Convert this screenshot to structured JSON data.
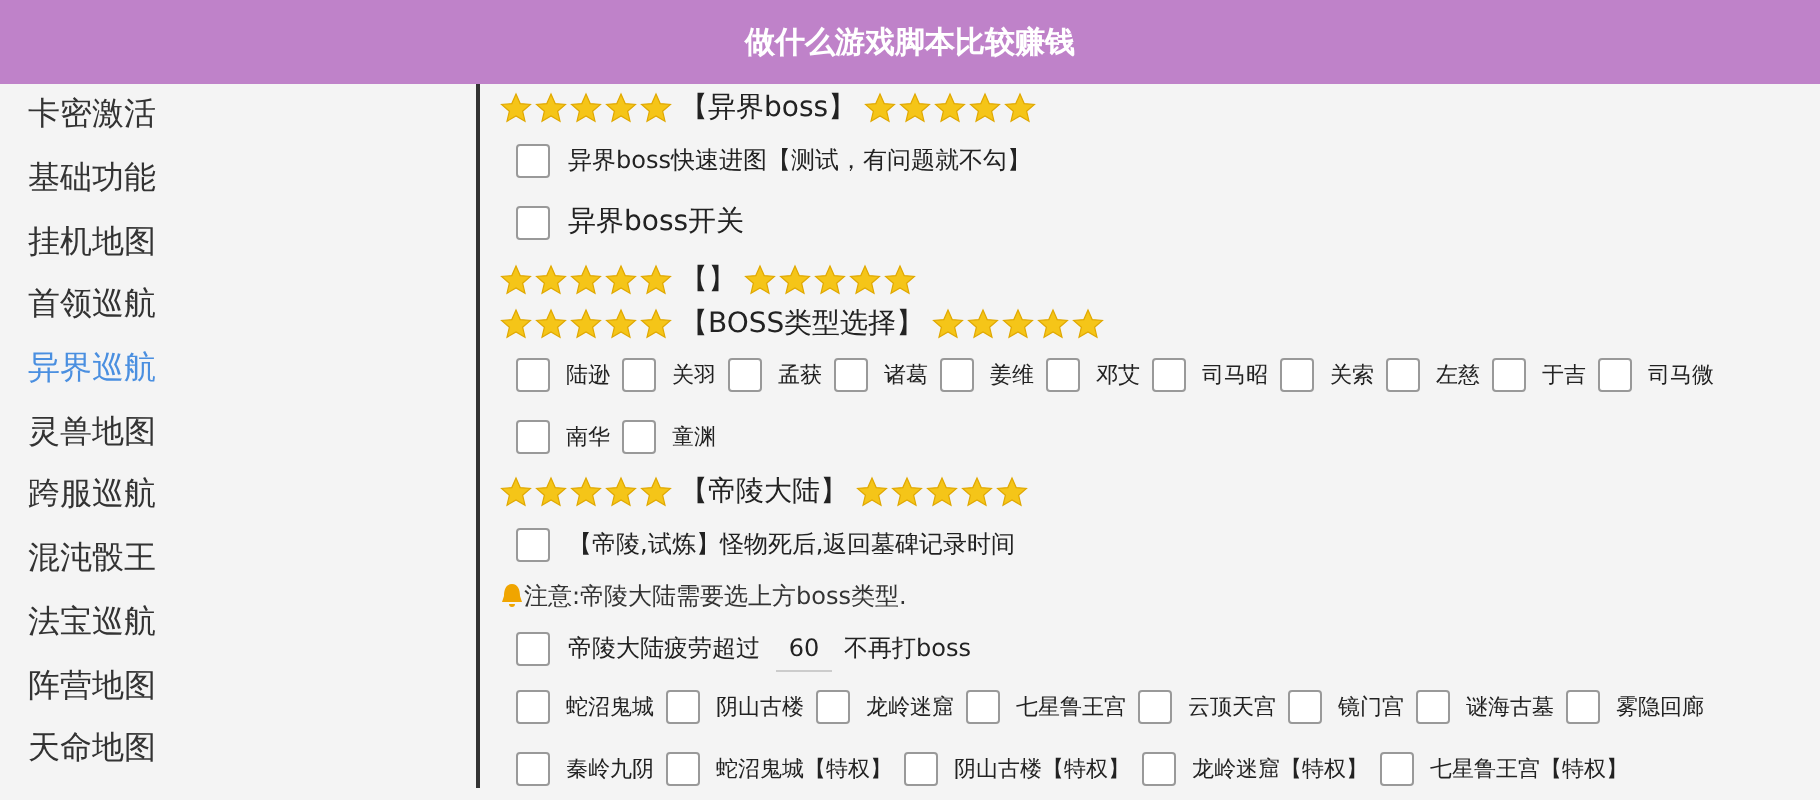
{
  "banner": {
    "title": "做什么游戏脚本比较赚钱"
  },
  "sidebar": {
    "items": [
      {
        "label": "卡密激活",
        "selected": false
      },
      {
        "label": "基础功能",
        "selected": false
      },
      {
        "label": "挂机地图",
        "selected": false
      },
      {
        "label": "首领巡航",
        "selected": false
      },
      {
        "label": "异界巡航",
        "selected": true
      },
      {
        "label": "灵兽地图",
        "selected": false
      },
      {
        "label": "跨服巡航",
        "selected": false
      },
      {
        "label": "混沌骰王",
        "selected": false
      },
      {
        "label": "法宝巡航",
        "selected": false
      },
      {
        "label": "阵营地图",
        "selected": false
      },
      {
        "label": "天命地图",
        "selected": false
      }
    ]
  },
  "content": [
    {
      "kind": "header",
      "title": "【异界boss】"
    },
    {
      "kind": "checkbox",
      "label": "异界boss快速进图【测试，有问题就不勾】",
      "checked": false
    },
    {
      "kind": "checkbox",
      "label": "异界boss开关",
      "checked": false,
      "large": true
    },
    {
      "kind": "header",
      "title": "【】"
    },
    {
      "kind": "header",
      "title": "【BOSS类型选择】"
    },
    {
      "kind": "grid",
      "options": [
        {
          "label": "陆逊",
          "checked": false
        },
        {
          "label": "关羽",
          "checked": false
        },
        {
          "label": "孟获",
          "checked": false
        },
        {
          "label": "诸葛",
          "checked": false
        },
        {
          "label": "姜维",
          "checked": false
        },
        {
          "label": "邓艾",
          "checked": false
        },
        {
          "label": "司马昭",
          "checked": false
        },
        {
          "label": "关索",
          "checked": false
        },
        {
          "label": "左慈",
          "checked": false
        },
        {
          "label": "于吉",
          "checked": false
        },
        {
          "label": "司马微",
          "checked": false
        },
        {
          "label": "南华",
          "checked": false
        },
        {
          "label": "童渊",
          "checked": false
        }
      ]
    },
    {
      "kind": "header",
      "title": "【帝陵大陆】"
    },
    {
      "kind": "checkbox",
      "label": "【帝陵,试炼】怪物死后,返回墓碑记录时间",
      "checked": false
    },
    {
      "kind": "note",
      "text": "注意:帝陵大陆需要选上方boss类型."
    },
    {
      "kind": "input",
      "label": "帝陵大陆疲劳超过",
      "value": "60",
      "suffix": "不再打boss",
      "checked": false
    },
    {
      "kind": "grid",
      "options": [
        {
          "label": "蛇沼鬼城",
          "checked": false
        },
        {
          "label": "阴山古楼",
          "checked": false
        },
        {
          "label": "龙岭迷窟",
          "checked": false
        },
        {
          "label": "七星鲁王宫",
          "checked": false
        },
        {
          "label": "云顶天宫",
          "checked": false
        },
        {
          "label": "镜门宫",
          "checked": false
        },
        {
          "label": "谜海古墓",
          "checked": false
        },
        {
          "label": "雾隐回廊",
          "checked": false
        },
        {
          "label": "秦岭九阴",
          "checked": false
        },
        {
          "label": "蛇沼鬼城【特权】",
          "checked": false
        },
        {
          "label": "阴山古楼【特权】",
          "checked": false
        },
        {
          "label": "龙岭迷窟【特权】",
          "checked": false
        },
        {
          "label": "七星鲁王宫【特权】",
          "checked": false
        }
      ]
    }
  ]
}
